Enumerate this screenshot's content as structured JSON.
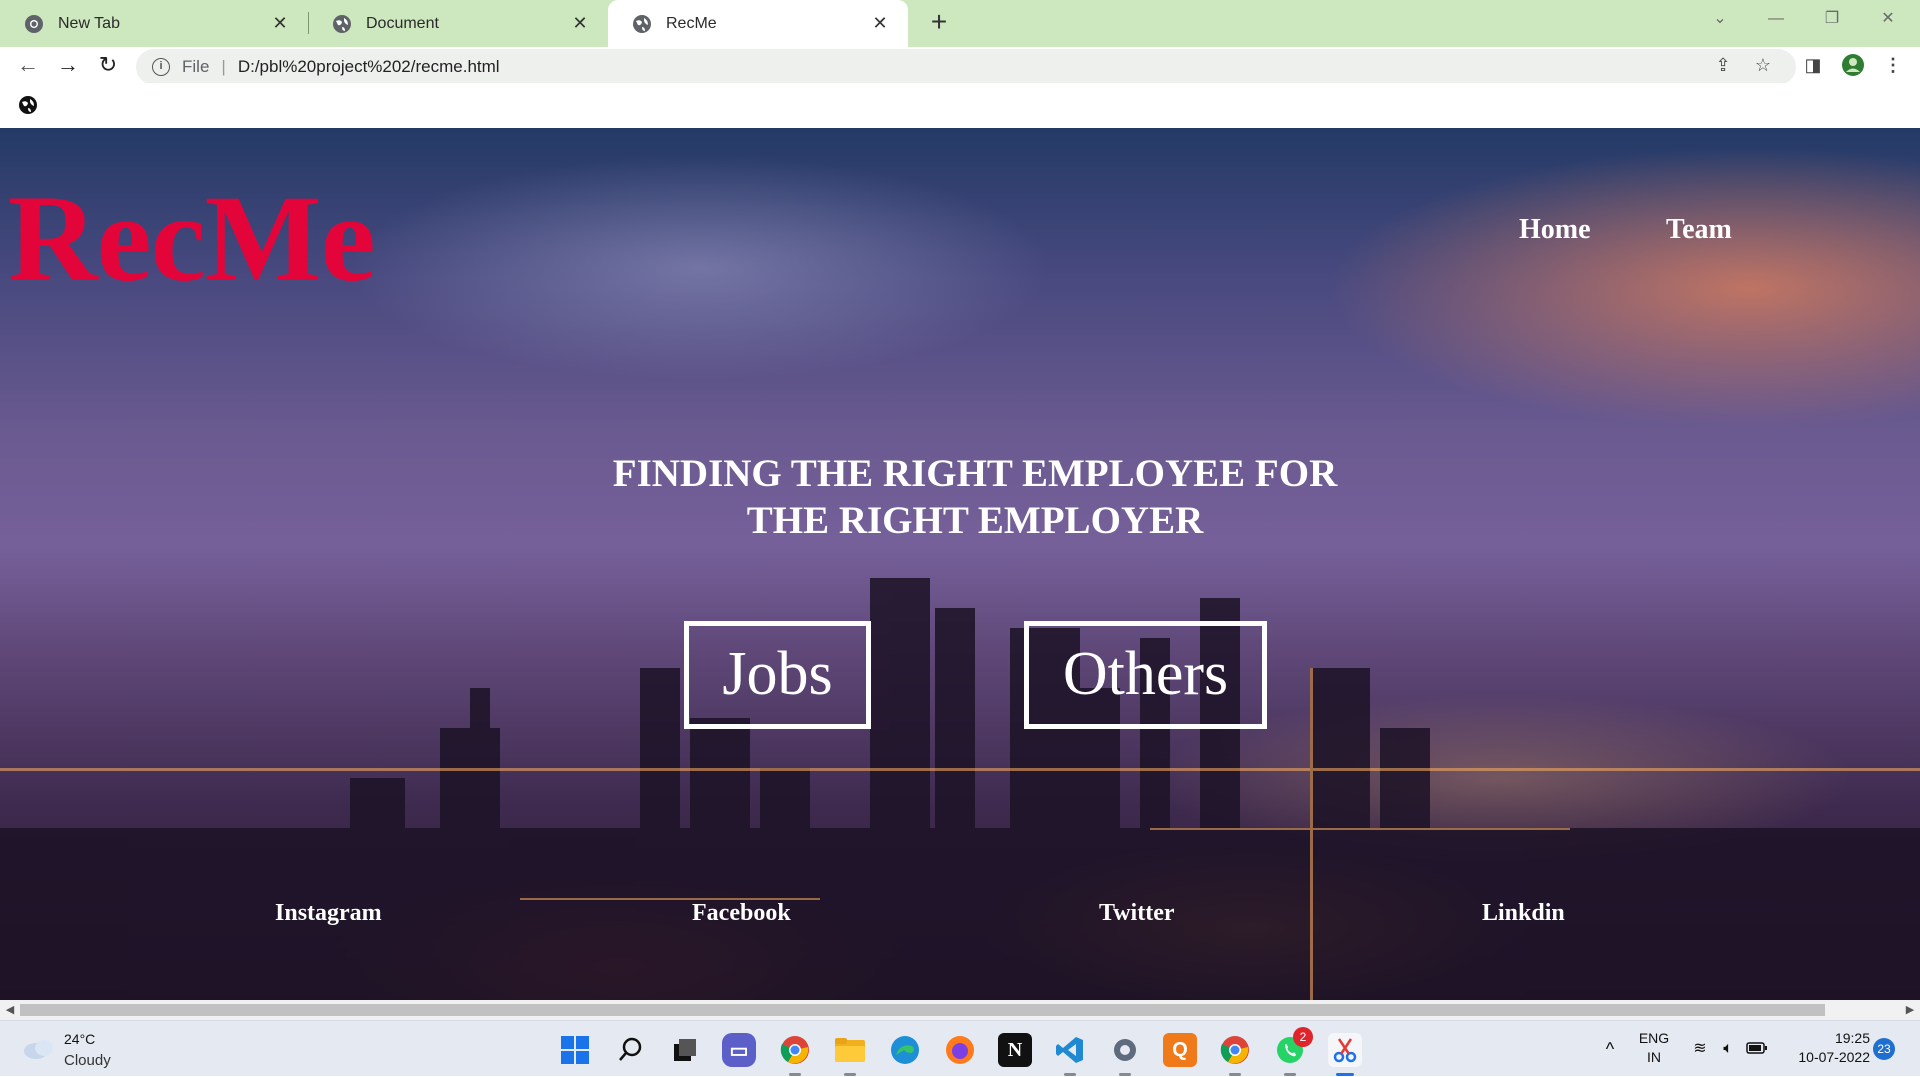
{
  "browser": {
    "tabs": [
      {
        "title": "New Tab",
        "icon": "chrome-icon"
      },
      {
        "title": "Document",
        "icon": "globe-icon"
      },
      {
        "title": "RecMe",
        "icon": "globe-icon",
        "active": true
      }
    ],
    "address": {
      "scheme_label": "File",
      "url": "D:/pbl%20project%202/recme.html"
    }
  },
  "site": {
    "brand": "RecMe",
    "brand_color": "#e3053a",
    "nav": [
      {
        "label": "Home"
      },
      {
        "label": "Team"
      }
    ],
    "headline_line1": "FINDING THE RIGHT EMPLOYEE FOR",
    "headline_line2": "THE RIGHT EMPLOYER",
    "buttons": [
      {
        "label": "Jobs"
      },
      {
        "label": "Others"
      }
    ],
    "social": [
      {
        "label": "Instagram"
      },
      {
        "label": "Facebook"
      },
      {
        "label": "Twitter"
      },
      {
        "label": "Linkdin"
      }
    ]
  },
  "taskbar": {
    "weather": {
      "temp": "24°C",
      "condition": "Cloudy"
    },
    "apps": [
      {
        "name": "start"
      },
      {
        "name": "search"
      },
      {
        "name": "task-view"
      },
      {
        "name": "chat"
      },
      {
        "name": "chrome"
      },
      {
        "name": "file-explorer"
      },
      {
        "name": "edge"
      },
      {
        "name": "firefox"
      },
      {
        "name": "notion",
        "glyph": "N"
      },
      {
        "name": "vscode"
      },
      {
        "name": "settings"
      },
      {
        "name": "qbittorrent",
        "glyph": "Q"
      },
      {
        "name": "chrome-profile"
      },
      {
        "name": "whatsapp",
        "badge": "2"
      },
      {
        "name": "snipping-tool"
      }
    ],
    "tray": {
      "language": "ENG",
      "region": "IN",
      "time": "19:25",
      "date": "10-07-2022",
      "notifications": "23"
    }
  }
}
